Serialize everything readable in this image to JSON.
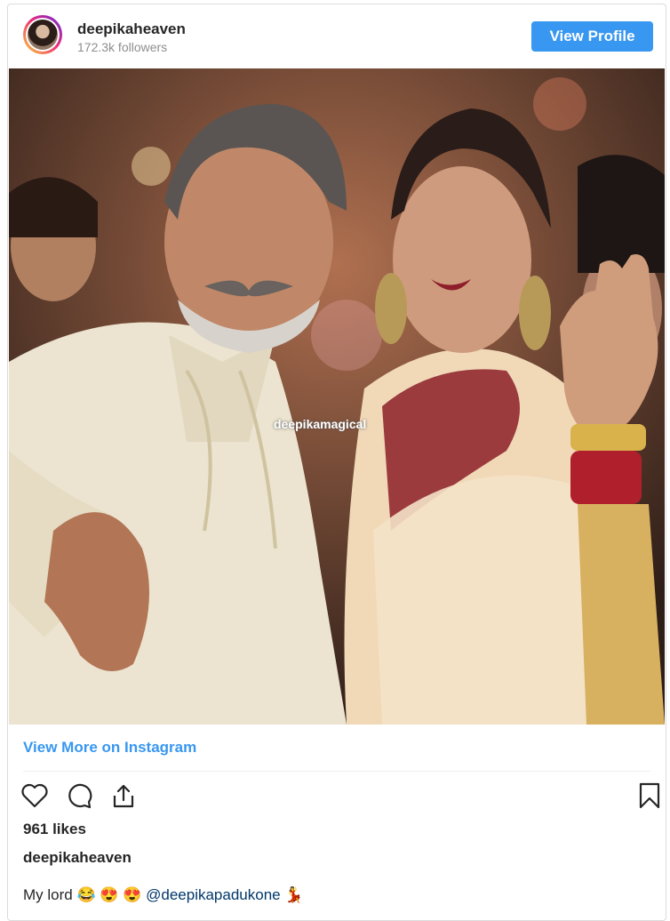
{
  "post": {
    "username": "deepikaheaven",
    "followers": "172.3k followers",
    "view_profile_label": "View Profile",
    "watermark": "deepikamagical",
    "view_more_label": "View More on Instagram",
    "likes": "961 likes",
    "owner": "deepikaheaven",
    "caption_text": "My lord 😂 😍 😍 ",
    "caption_mention": "@deepikapadukone",
    "caption_emoji_end": " 💃",
    "icons": [
      "avatar",
      "heart-icon",
      "comment-icon",
      "share-icon",
      "bookmark-icon"
    ]
  }
}
